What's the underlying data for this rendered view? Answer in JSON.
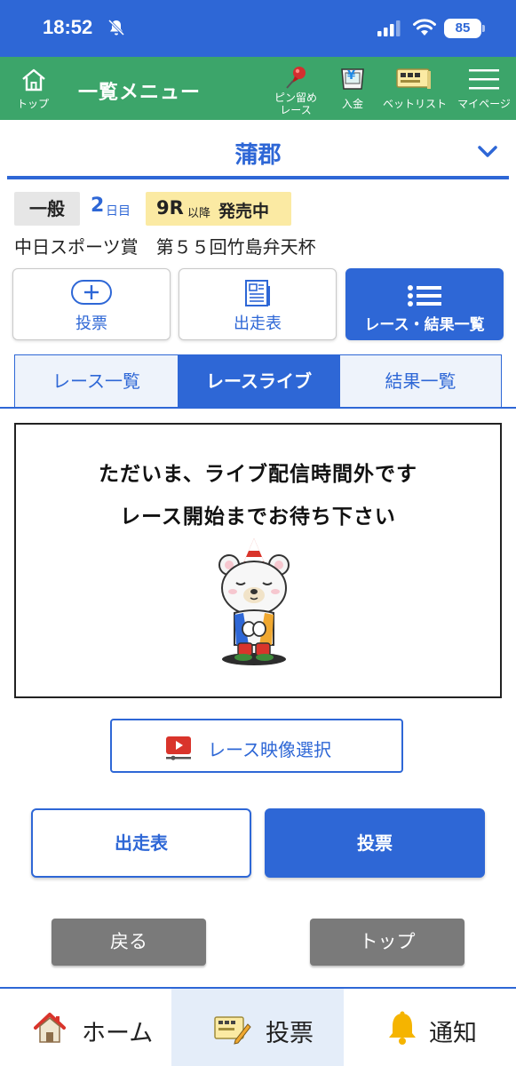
{
  "status_bar": {
    "time": "18:52",
    "battery": "85"
  },
  "header": {
    "top_label": "トップ",
    "title": "一覧メニュー",
    "pin_label_1": "ピン留め",
    "pin_label_2": "レース",
    "deposit_label": "入金",
    "betlist_label": "ベットリスト",
    "mypage_label": "マイページ",
    "yen_symbol": "¥"
  },
  "venue": {
    "name": "蒲郡"
  },
  "race_info": {
    "grade": "一般",
    "day_number": "2",
    "day_unit": "日目",
    "sale_race": "9R",
    "sale_small": "以降",
    "sale_status": "発売中",
    "title": "中日スポーツ賞　第５５回竹島弁天杯"
  },
  "actions": [
    {
      "label": "投票",
      "icon": "plus-circle-icon"
    },
    {
      "label": "出走表",
      "icon": "newspaper-icon"
    },
    {
      "label": "レース・結果一覧",
      "icon": "list-icon"
    }
  ],
  "tabs": [
    {
      "label": "レース一覧"
    },
    {
      "label": "レースライブ"
    },
    {
      "label": "結果一覧"
    }
  ],
  "live": {
    "line1": "ただいま、ライブ配信時間外です",
    "line2": "レース開始までお待ち下さい"
  },
  "video_select": {
    "label": "レース映像選択"
  },
  "pair_buttons": {
    "entry_label": "出走表",
    "vote_label": "投票"
  },
  "nav_buttons": {
    "back_label": "戻る",
    "top_label": "トップ"
  },
  "bottom_bar": {
    "home": "ホーム",
    "vote": "投票",
    "notify": "通知"
  },
  "colors": {
    "accent": "#2e67d6",
    "header_green": "#3ca56a",
    "sale_yellow": "#fbeaa3"
  }
}
